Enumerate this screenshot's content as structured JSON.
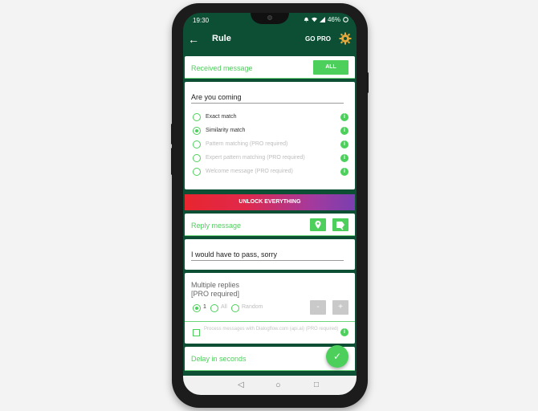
{
  "status_bar": {
    "time": "19:30",
    "battery": "46%"
  },
  "app_bar": {
    "title": "Rule",
    "go_pro": "GO PRO"
  },
  "received": {
    "title": "Received message",
    "all_button": "ALL",
    "input_value": "Are you coming",
    "options": [
      {
        "label": "Exact match",
        "selected": false,
        "enabled": true
      },
      {
        "label": "Similarity match",
        "selected": true,
        "enabled": true
      },
      {
        "label": "Pattern matching (PRO required)",
        "selected": false,
        "enabled": false
      },
      {
        "label": "Expert pattern matching (PRO required)",
        "selected": false,
        "enabled": false
      },
      {
        "label": "Welcome message (PRO required)",
        "selected": false,
        "enabled": false
      }
    ]
  },
  "unlock_label": "UNLOCK EVERYTHING",
  "reply": {
    "title": "Reply message",
    "input_value": "I would have to pass, sorry"
  },
  "multiple": {
    "label_line1": "Multiple replies",
    "label_line2": "[PRO required]",
    "choices": [
      "1",
      "All",
      "Random"
    ],
    "minus": "-",
    "plus": "+",
    "process_text": "Process messages with Dialogflow.com (api.ai) (PRO required)"
  },
  "delay": {
    "title": "Delay in seconds"
  },
  "colors": {
    "accent": "#4cd05b",
    "dark_green": "#0c4f34"
  }
}
